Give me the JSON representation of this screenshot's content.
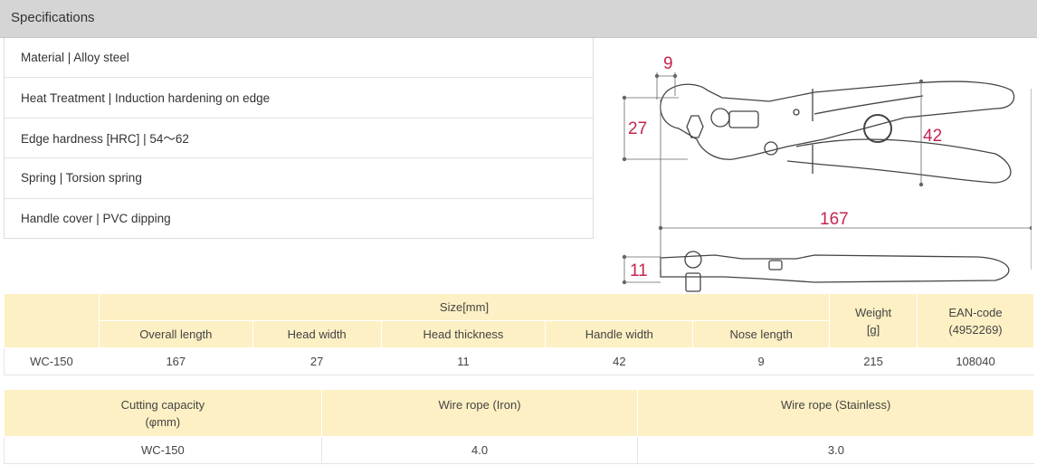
{
  "header": {
    "title": "Specifications"
  },
  "specs": [
    "Material | Alloy steel",
    "Heat Treatment | Induction hardening on edge",
    "Edge hardness [HRC] | 54～62",
    "Spring | Torsion spring",
    "Handle cover | PVC dipping"
  ],
  "drawing": {
    "dim_nose": "9",
    "dim_head_width": "27",
    "dim_handle_width": "42",
    "dim_overall_length": "167",
    "dim_head_thickness": "11",
    "accent_color": "#c4254e"
  },
  "size_table": {
    "group_header": "Size[mm]",
    "columns": [
      "Overall length",
      "Head width",
      "Head thickness",
      "Handle width",
      "Nose length"
    ],
    "weight_header_1": "Weight",
    "weight_header_2": "[g]",
    "ean_header_1": "EAN-code",
    "ean_header_2": "(4952269)",
    "row": {
      "model": "WC-150",
      "overall_length": "167",
      "head_width": "27",
      "head_thickness": "11",
      "handle_width": "42",
      "nose_length": "9",
      "weight": "215",
      "ean": "108040"
    }
  },
  "capacity_table": {
    "header_1": "Cutting capacity",
    "header_2": "(φmm)",
    "iron_header": "Wire rope (Iron)",
    "stainless_header": "Wire rope (Stainless)",
    "row": {
      "model": "WC-150",
      "iron": "4.0",
      "stainless": "3.0"
    }
  }
}
